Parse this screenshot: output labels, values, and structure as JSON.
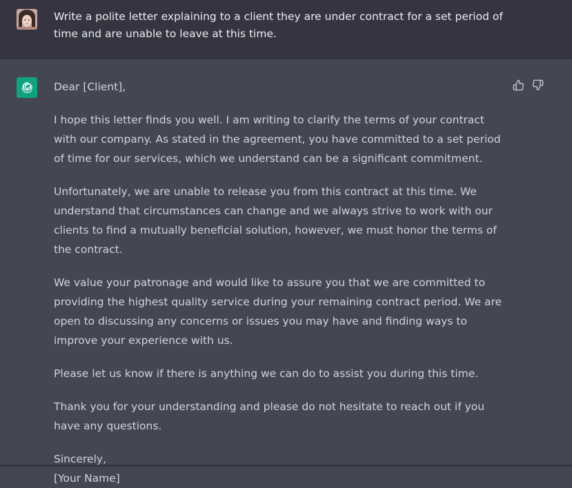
{
  "user": {
    "avatar": "user-avatar-photo",
    "prompt": "Write a polite letter explaining to a client they are under contract for a set period of time and are unable to leave at this time."
  },
  "assistant": {
    "avatar_icon": "openai-logo-icon",
    "paragraphs": [
      "Dear [Client],",
      "I hope this letter finds you well. I am writing to clarify the terms of your contract with our company. As stated in the agreement, you have committed to a set period of time for our services, which we understand can be a significant commitment.",
      "Unfortunately, we are unable to release you from this contract at this time. We understand that circumstances can change and we always strive to work with our clients to find a mutually beneficial solution, however, we must honor the terms of the contract.",
      "We value your patronage and would like to assure you that we are committed to providing the highest quality service during your remaining contract period. We are open to discussing any concerns or issues you may have and finding ways to improve your experience with us.",
      "Please let us know if there is anything we can do to assist you during this time.",
      "Thank you for your understanding and please do not hesitate to reach out if you have any questions."
    ],
    "sign_off": "Sincerely,",
    "signature": "[Your Name]"
  },
  "feedback": {
    "up_icon": "thumbs-up-icon",
    "down_icon": "thumbs-down-icon"
  },
  "colors": {
    "user_bg": "#343541",
    "assistant_bg": "#444654",
    "brand": "#10a37f",
    "text": "#d1d5db"
  }
}
